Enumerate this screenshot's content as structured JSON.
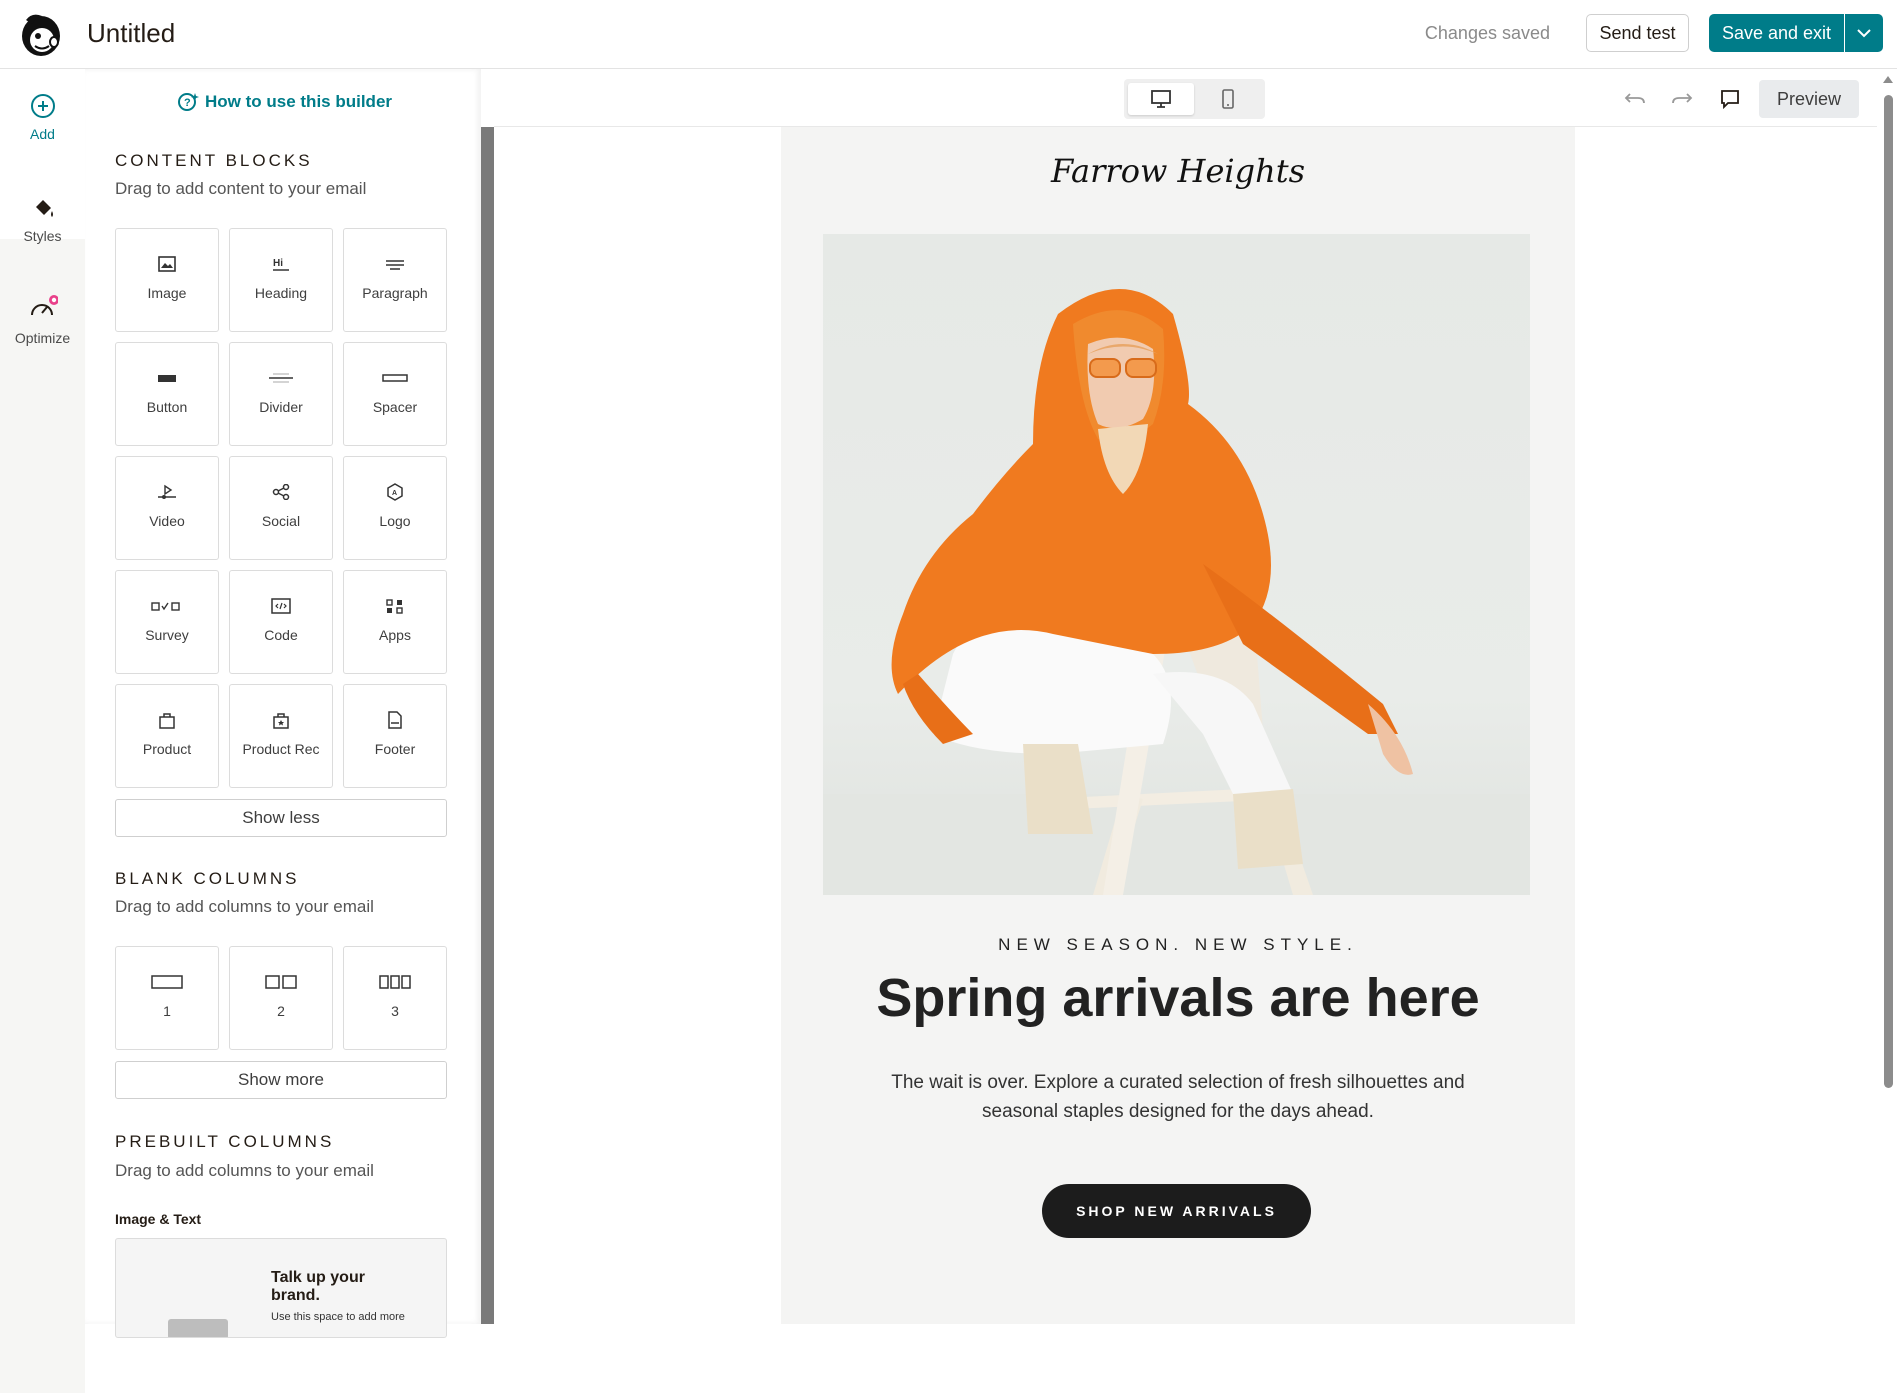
{
  "header": {
    "title": "Untitled",
    "status": "Changes saved",
    "send_test_label": "Send test",
    "save_exit_label": "Save and exit"
  },
  "rail": {
    "items": [
      {
        "label": "Add",
        "icon": "plus-circle-icon",
        "active": true
      },
      {
        "label": "Styles",
        "icon": "paint-bucket-icon",
        "active": false
      },
      {
        "label": "Optimize",
        "icon": "gauge-icon",
        "active": false
      }
    ]
  },
  "panel": {
    "howto_label": "How to use this builder",
    "content_blocks": {
      "title": "CONTENT BLOCKS",
      "subtitle": "Drag to add content to your email",
      "items": [
        "Image",
        "Heading",
        "Paragraph",
        "Button",
        "Divider",
        "Spacer",
        "Video",
        "Social",
        "Logo",
        "Survey",
        "Code",
        "Apps",
        "Product",
        "Product Rec",
        "Footer"
      ],
      "toggle_label": "Show less"
    },
    "blank_columns": {
      "title": "BLANK COLUMNS",
      "subtitle": "Drag to add columns to your email",
      "items": [
        "1",
        "2",
        "3"
      ],
      "toggle_label": "Show more"
    },
    "prebuilt_columns": {
      "title": "PREBUILT COLUMNS",
      "subtitle": "Drag to add columns to your email",
      "group_label": "Image & Text",
      "card_title": "Talk up your brand.",
      "card_text": "Use this space to add more"
    }
  },
  "toolbar": {
    "preview_label": "Preview",
    "active_device": "desktop"
  },
  "email": {
    "brand": "Farrow Heights",
    "eyebrow": "NEW SEASON. NEW STYLE.",
    "headline": "Spring arrivals are here",
    "body": "The wait is over. Explore a curated selection of fresh silhouettes and seasonal staples designed for the days ahead.",
    "cta": "SHOP NEW ARRIVALS"
  },
  "colors": {
    "accent": "#007c89",
    "cta_bg": "#1c1c1c",
    "hoodie": "#f07a1f"
  }
}
